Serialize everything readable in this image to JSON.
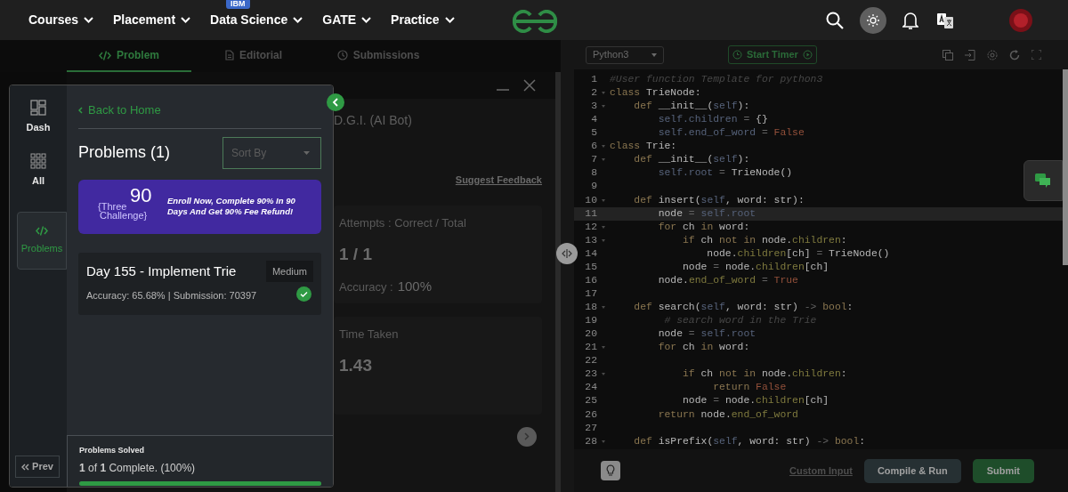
{
  "nav": {
    "items": [
      {
        "label": "Courses"
      },
      {
        "label": "Placement"
      },
      {
        "label": "Data Science",
        "badge": "IBM"
      },
      {
        "label": "GATE"
      },
      {
        "label": "Practice"
      }
    ]
  },
  "problem_tabs": [
    {
      "label": "Problem",
      "kind": "code",
      "selected": true
    },
    {
      "label": "Editorial",
      "kind": "document",
      "selected": false
    },
    {
      "label": "Submissions",
      "kind": "clock",
      "selected": false
    }
  ],
  "background_panel": {
    "header": "D.G.I. (AI Bot)",
    "feedback_link": "Suggest Feedback",
    "cards": [
      {
        "label": "Attempts : Correct / Total",
        "value": "1 / 1",
        "detail_label": "Accuracy :",
        "detail_value": "100%"
      },
      {
        "label": "Time Taken",
        "value": "1.43"
      }
    ]
  },
  "problems_modal": {
    "sidebar": [
      {
        "label": "Dash",
        "kind": "dashboard",
        "selected": false
      },
      {
        "label": "All",
        "kind": "grid",
        "selected": false
      },
      {
        "label": "Problems",
        "kind": "code",
        "selected": true
      }
    ],
    "prev_button": "Prev",
    "back_link": "Back to Home",
    "heading": "Problems (1)",
    "sort": {
      "placeholder": "Sort By"
    },
    "banner": {
      "logo_top": "{Three",
      "logo_number": "90",
      "logo_bottom": "Challenge}",
      "text": "Enroll Now, Complete 90% In 90 Days And Get 90% Fee Refund!"
    },
    "problems": [
      {
        "title": "Day 155 - Implement Trie",
        "difficulty": "Medium",
        "stats": "Accuracy: 65.68% | Submission: 70397",
        "solved": true
      }
    ],
    "progress": {
      "label": "Problems Solved",
      "summary": "**1** of **1** Complete. (100%)",
      "level": 1
    }
  },
  "editor": {
    "language": "Python3",
    "timer_button": "Start Timer",
    "custom_input": "Custom Input",
    "compile_button": "Compile & Run",
    "submit_button": "Submit",
    "lines": [
      {
        "number": "1",
        "foldable": false,
        "current": false,
        "tokens": [
          {
            "kind": "comment",
            "text": "#User function Template for python3"
          }
        ]
      },
      {
        "number": "2",
        "foldable": true,
        "current": false,
        "tokens": [
          {
            "kind": "kw",
            "text": "class"
          },
          {
            "kind": "plain",
            "text": " TrieNode:"
          }
        ]
      },
      {
        "number": "3",
        "foldable": true,
        "current": false,
        "tokens": [
          {
            "kind": "kw",
            "text": "    def"
          },
          {
            "kind": "plain",
            "text": " __init__("
          },
          {
            "kind": "self",
            "text": "self"
          },
          {
            "kind": "plain",
            "text": "):"
          }
        ]
      },
      {
        "number": "4",
        "foldable": false,
        "current": false,
        "tokens": [
          {
            "kind": "self",
            "text": "        self.children"
          },
          {
            "kind": "op",
            "text": " = "
          },
          {
            "kind": "plain",
            "text": "{}"
          }
        ]
      },
      {
        "number": "5",
        "foldable": false,
        "current": false,
        "tokens": [
          {
            "kind": "self",
            "text": "        self.end_of_word"
          },
          {
            "kind": "op",
            "text": " = "
          },
          {
            "kind": "const",
            "text": "False"
          }
        ]
      },
      {
        "number": "6",
        "foldable": true,
        "current": false,
        "tokens": [
          {
            "kind": "kw",
            "text": "class"
          },
          {
            "kind": "plain",
            "text": " Trie:"
          }
        ]
      },
      {
        "number": "7",
        "foldable": true,
        "current": false,
        "tokens": [
          {
            "kind": "kw",
            "text": "    def"
          },
          {
            "kind": "plain",
            "text": " __init__("
          },
          {
            "kind": "self",
            "text": "self"
          },
          {
            "kind": "plain",
            "text": "):"
          }
        ]
      },
      {
        "number": "8",
        "foldable": false,
        "current": false,
        "tokens": [
          {
            "kind": "self",
            "text": "        self.root"
          },
          {
            "kind": "op",
            "text": " = "
          },
          {
            "kind": "plain",
            "text": "TrieNode()"
          }
        ]
      },
      {
        "number": "9",
        "foldable": false,
        "current": false
      },
      {
        "number": "10",
        "foldable": true,
        "current": false,
        "tokens": [
          {
            "kind": "kw",
            "text": "    def"
          },
          {
            "kind": "plain",
            "text": " insert("
          },
          {
            "kind": "self",
            "text": "self"
          },
          {
            "kind": "plain",
            "text": ", word: str):"
          }
        ]
      },
      {
        "number": "11",
        "foldable": false,
        "current": true,
        "tokens": [
          {
            "kind": "plain",
            "text": "        node"
          },
          {
            "kind": "op",
            "text": " = "
          },
          {
            "kind": "self",
            "text": "self.root"
          }
        ]
      },
      {
        "number": "12",
        "foldable": true,
        "current": false,
        "tokens": [
          {
            "kind": "kw",
            "text": "        for"
          },
          {
            "kind": "plain",
            "text": " ch "
          },
          {
            "kind": "kw",
            "text": "in"
          },
          {
            "kind": "plain",
            "text": " word:"
          }
        ]
      },
      {
        "number": "13",
        "foldable": true,
        "current": false,
        "tokens": [
          {
            "kind": "kw",
            "text": "            if"
          },
          {
            "kind": "plain",
            "text": " ch "
          },
          {
            "kind": "kw",
            "text": "not in"
          },
          {
            "kind": "plain",
            "text": " node."
          },
          {
            "kind": "attr",
            "text": "children"
          },
          {
            "kind": "plain",
            "text": ":"
          }
        ]
      },
      {
        "number": "14",
        "foldable": false,
        "current": false,
        "tokens": [
          {
            "kind": "plain",
            "text": "                node."
          },
          {
            "kind": "attr",
            "text": "children"
          },
          {
            "kind": "plain",
            "text": "[ch]"
          },
          {
            "kind": "op",
            "text": " = "
          },
          {
            "kind": "plain",
            "text": "TrieNode()"
          }
        ]
      },
      {
        "number": "15",
        "foldable": false,
        "current": false,
        "tokens": [
          {
            "kind": "plain",
            "text": "            node"
          },
          {
            "kind": "op",
            "text": " = "
          },
          {
            "kind": "plain",
            "text": "node."
          },
          {
            "kind": "attr",
            "text": "children"
          },
          {
            "kind": "plain",
            "text": "[ch]"
          }
        ]
      },
      {
        "number": "16",
        "foldable": false,
        "current": false,
        "tokens": [
          {
            "kind": "plain",
            "text": "        node."
          },
          {
            "kind": "attr",
            "text": "end_of_word"
          },
          {
            "kind": "op",
            "text": " = "
          },
          {
            "kind": "const",
            "text": "True"
          }
        ]
      },
      {
        "number": "17",
        "foldable": false,
        "current": false
      },
      {
        "number": "18",
        "foldable": true,
        "current": false,
        "tokens": [
          {
            "kind": "kw",
            "text": "    def"
          },
          {
            "kind": "plain",
            "text": " search("
          },
          {
            "kind": "self",
            "text": "self"
          },
          {
            "kind": "plain",
            "text": ", word: str)"
          },
          {
            "kind": "op",
            "text": " -> "
          },
          {
            "kind": "kw",
            "text": "bool"
          },
          {
            "kind": "plain",
            "text": ":"
          }
        ]
      },
      {
        "number": "19",
        "foldable": false,
        "current": false,
        "tokens": [
          {
            "kind": "comment",
            "text": "         # search word in the Trie"
          }
        ]
      },
      {
        "number": "20",
        "foldable": false,
        "current": false,
        "tokens": [
          {
            "kind": "plain",
            "text": "        node"
          },
          {
            "kind": "op",
            "text": " = "
          },
          {
            "kind": "self",
            "text": "self.root"
          }
        ]
      },
      {
        "number": "21",
        "foldable": true,
        "current": false,
        "tokens": [
          {
            "kind": "kw",
            "text": "        for"
          },
          {
            "kind": "plain",
            "text": " ch "
          },
          {
            "kind": "kw",
            "text": "in"
          },
          {
            "kind": "plain",
            "text": " word:"
          }
        ]
      },
      {
        "number": "22",
        "foldable": false,
        "current": false
      },
      {
        "number": "23",
        "foldable": true,
        "current": false,
        "tokens": [
          {
            "kind": "kw",
            "text": "            if"
          },
          {
            "kind": "plain",
            "text": " ch "
          },
          {
            "kind": "kw",
            "text": "not in"
          },
          {
            "kind": "plain",
            "text": " node."
          },
          {
            "kind": "attr",
            "text": "children"
          },
          {
            "kind": "plain",
            "text": ":"
          }
        ]
      },
      {
        "number": "24",
        "foldable": false,
        "current": false,
        "tokens": [
          {
            "kind": "kw",
            "text": "                 return"
          },
          {
            "kind": "const",
            "text": " False"
          }
        ]
      },
      {
        "number": "25",
        "foldable": false,
        "current": false,
        "tokens": [
          {
            "kind": "plain",
            "text": "            node"
          },
          {
            "kind": "op",
            "text": " = "
          },
          {
            "kind": "plain",
            "text": "node."
          },
          {
            "kind": "attr",
            "text": "children"
          },
          {
            "kind": "plain",
            "text": "[ch]"
          }
        ]
      },
      {
        "number": "26",
        "foldable": false,
        "current": false,
        "tokens": [
          {
            "kind": "kw",
            "text": "        return"
          },
          {
            "kind": "plain",
            "text": " node."
          },
          {
            "kind": "attr",
            "text": "end_of_word"
          }
        ]
      },
      {
        "number": "27",
        "foldable": false,
        "current": false
      },
      {
        "number": "28",
        "foldable": true,
        "current": false,
        "tokens": [
          {
            "kind": "kw",
            "text": "    def"
          },
          {
            "kind": "plain",
            "text": " isPrefix("
          },
          {
            "kind": "self",
            "text": "self"
          },
          {
            "kind": "plain",
            "text": ", word: str)"
          },
          {
            "kind": "op",
            "text": " -> "
          },
          {
            "kind": "kw",
            "text": "bool"
          },
          {
            "kind": "plain",
            "text": ":"
          }
        ]
      }
    ]
  }
}
